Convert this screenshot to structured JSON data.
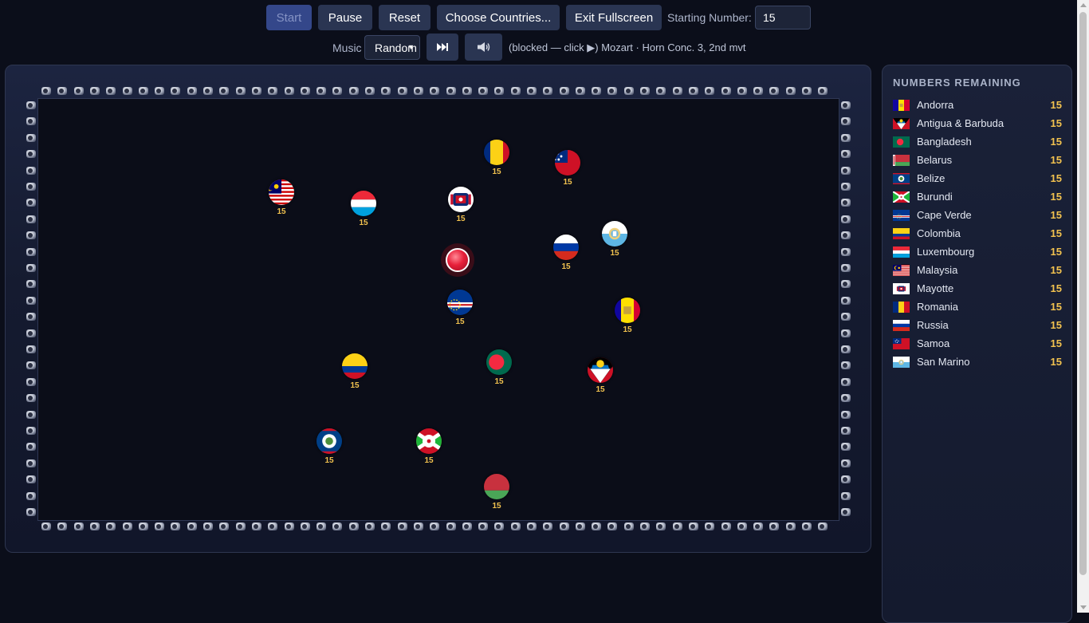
{
  "toolbar": {
    "start_label": "Start",
    "pause_label": "Pause",
    "reset_label": "Reset",
    "choose_label": "Choose Countries...",
    "fullscreen_label": "Exit Fullscreen",
    "starting_number_label": "Starting Number:",
    "starting_number_value": "15",
    "music_label": "Music",
    "music_selected": "Random",
    "skip_icon": "next-track-icon",
    "volume_icon": "speaker-icon",
    "status_text": "(blocked — click ▶) Mozart · Horn Conc. 3, 2nd mvt"
  },
  "sidebar": {
    "title": "NUMBERS REMAINING",
    "items": [
      {
        "name": "Andorra",
        "count": "15",
        "flag": "andorra"
      },
      {
        "name": "Antigua & Barbuda",
        "count": "15",
        "flag": "antigua"
      },
      {
        "name": "Bangladesh",
        "count": "15",
        "flag": "bangladesh"
      },
      {
        "name": "Belarus",
        "count": "15",
        "flag": "belarus"
      },
      {
        "name": "Belize",
        "count": "15",
        "flag": "belize"
      },
      {
        "name": "Burundi",
        "count": "15",
        "flag": "burundi"
      },
      {
        "name": "Cape Verde",
        "count": "15",
        "flag": "capeverde"
      },
      {
        "name": "Colombia",
        "count": "15",
        "flag": "colombia"
      },
      {
        "name": "Luxembourg",
        "count": "15",
        "flag": "luxembourg"
      },
      {
        "name": "Malaysia",
        "count": "15",
        "flag": "malaysia"
      },
      {
        "name": "Mayotte",
        "count": "15",
        "flag": "mayotte"
      },
      {
        "name": "Romania",
        "count": "15",
        "flag": "romania"
      },
      {
        "name": "Russia",
        "count": "15",
        "flag": "russia"
      },
      {
        "name": "Samoa",
        "count": "15",
        "flag": "samoa"
      },
      {
        "name": "San Marino",
        "count": "15",
        "flag": "sanmarino"
      }
    ]
  },
  "balls": [
    {
      "country": "Romania",
      "number": "15"
    },
    {
      "country": "Samoa",
      "number": "15"
    },
    {
      "country": "Malaysia",
      "number": "15"
    },
    {
      "country": "Luxembourg",
      "number": "15"
    },
    {
      "country": "Mayotte",
      "number": "15"
    },
    {
      "country": "Russia",
      "number": "15"
    },
    {
      "country": "San Marino",
      "number": "15"
    },
    {
      "country": "Cape Verde",
      "number": "15"
    },
    {
      "country": "Andorra",
      "number": "15"
    },
    {
      "country": "Colombia",
      "number": "15"
    },
    {
      "country": "Bangladesh",
      "number": "15"
    },
    {
      "country": "Antigua & Barbuda",
      "number": "15"
    },
    {
      "country": "Belize",
      "number": "15"
    },
    {
      "country": "Burundi",
      "number": "15"
    },
    {
      "country": "Belarus",
      "number": "15"
    }
  ],
  "colors": {
    "background": "#0b0e1a",
    "accent_number": "#f2c24f",
    "button": "#2a3552",
    "start_button": "#34478a",
    "spawner": "#e8203a"
  }
}
